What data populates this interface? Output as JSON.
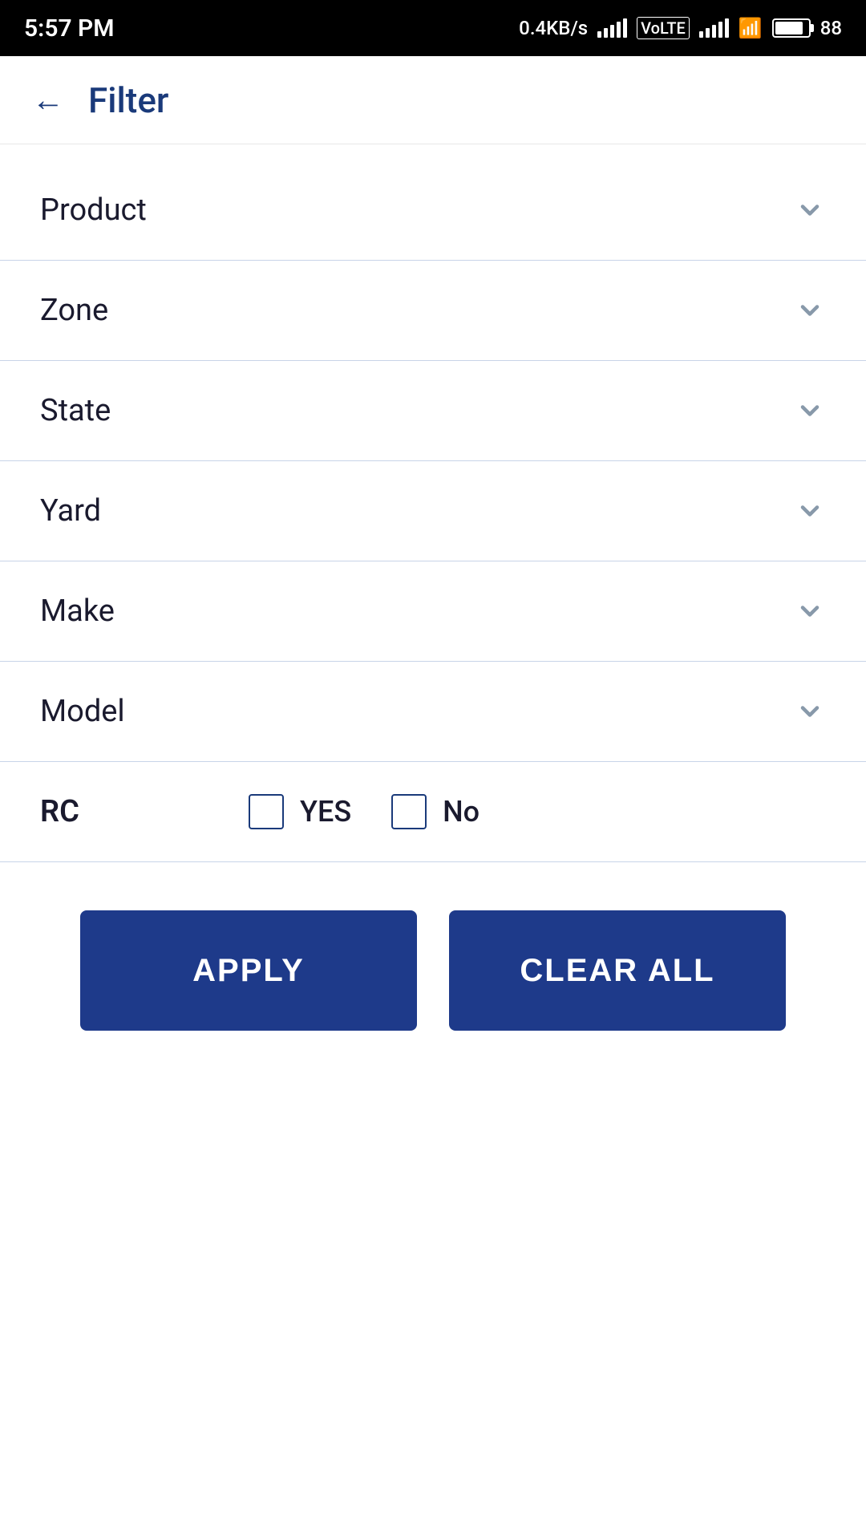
{
  "statusBar": {
    "time": "5:57 PM",
    "network": "0.4KB/s",
    "battery": "88"
  },
  "header": {
    "backLabel": "←",
    "title": "Filter"
  },
  "filters": [
    {
      "id": "product",
      "label": "Product"
    },
    {
      "id": "zone",
      "label": "Zone"
    },
    {
      "id": "state",
      "label": "State"
    },
    {
      "id": "yard",
      "label": "Yard"
    },
    {
      "id": "make",
      "label": "Make"
    },
    {
      "id": "model",
      "label": "Model"
    }
  ],
  "rcFilter": {
    "label": "RC",
    "yesLabel": "YES",
    "noLabel": "No"
  },
  "buttons": {
    "apply": "APPLY",
    "clearAll": "CLEAR ALL"
  }
}
